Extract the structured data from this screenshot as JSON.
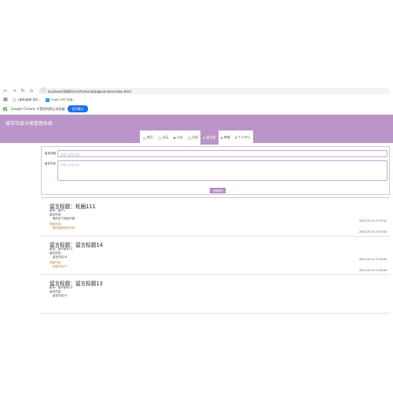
{
  "browser": {
    "url": "localhost:8080/cms/frontend/pages/index/index.html",
    "bookmarks": [
      {
        "label": "[推荐]推荐 项目..."
      },
      {
        "label": "Chat2 GPT 在线..."
      }
    ],
    "infobar_text": "Google Chrome 不是您的默认浏览器",
    "infobar_button": "设为默认"
  },
  "site": {
    "title": "城市垃圾分类管理系统",
    "nav": [
      {
        "icon": "◯",
        "label": "首页"
      },
      {
        "icon": "◯",
        "label": "论坛"
      },
      {
        "icon": "✚",
        "label": "公告"
      },
      {
        "icon": "◯",
        "label": "垃圾"
      },
      {
        "icon": "✉",
        "label": "留言板",
        "active": true
      },
      {
        "icon": "✉",
        "label": "商城"
      },
      {
        "icon": "A",
        "label": "个人中心"
      }
    ]
  },
  "form": {
    "title_label": "留言标题",
    "title_placeholder": "请输入留言标题",
    "content_label": "留言内容",
    "content_placeholder": "请输入留言内容",
    "submit_label": "立即提交"
  },
  "messages": [
    {
      "title": "留言标题：轮圈111",
      "user": "帐号：用户1",
      "content_label": "留言内容：",
      "content": "是的这个网站不错",
      "time1": "2023-03-14 17:19:41",
      "reply_label": "回复内容：",
      "reply": "是的谢谢您的支持",
      "time2": "2023-03-14 17:20:50"
    },
    {
      "title": "留言标题：留言标题14",
      "user": "帐号：用户帐号14",
      "content_label": "留言内容：",
      "content": "留言内容14",
      "time1": "2023-03-14 17:05:00",
      "reply_label": "回复内容：",
      "reply": "回复内容14",
      "time2": "2023-03-14 17:05:00"
    },
    {
      "title": "留言标题：留言标题13",
      "user": "帐号：用户帐号13",
      "content_label": "留言内容：",
      "content": "留言内容13",
      "time1": "",
      "reply_label": "",
      "reply": "",
      "time2": ""
    }
  ]
}
